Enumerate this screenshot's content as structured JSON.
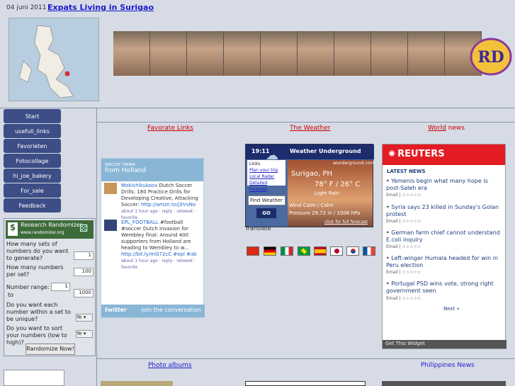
{
  "header": {
    "date": "04 juni 2011",
    "title": "Expats Living in Surigao"
  },
  "nav": [
    "Start",
    "usefull_links",
    "Favorieten",
    "Fotocollage",
    "hi_joe_bakery",
    "For_sale",
    "Feedback"
  ],
  "randomizer": {
    "title": "Research Randomizer",
    "url": "www.randomizer.org",
    "q1": "How many sets of numbers do you want to generate?",
    "v1": "1",
    "q2": "How many numbers per set?",
    "v2": "100",
    "q3": "Number range:",
    "from": "1",
    "to_label": "to",
    "to": "1000",
    "q4": "Do you want each number within a set to be unique?",
    "a4": "Ye",
    "q5": "Do you want to sort your numbers (low to high)?",
    "a5": "Ye",
    "button": "Randomize Now!"
  },
  "sections": {
    "fav": "Favorate Links",
    "weather": "The Weather",
    "world": "World",
    "world_news": " news",
    "photos": "Photo albums",
    "phil": "Philippines News"
  },
  "twitter": {
    "head1": "soccer news",
    "head2": "from Holland",
    "t1_user": "Mokichikukoov",
    "t1_text": " Dutch Soccer Drills: 180 Practice Drills for Developing Creative, Attacking Soccer: ",
    "t1_link": "http://amzn.to/j3VvNo",
    "t1_meta": "about 1 hour ago · reply · retweet · favorite",
    "t2_user": "EPL_FOOTBALL",
    "t2_text": " #football #soccer Dutch invasion for Wembley final: Around 400 supporters from Holland are heading to Wembley to w... ",
    "t2_link": "http://bit.ly/mG72cC #epl #ab",
    "t2_meta": "about 1 hour ago · reply · retweet · favorite",
    "foot": "twitter",
    "join": "join the conversation"
  },
  "weather": {
    "time": "19:11",
    "brand": "Weather Underground",
    "links": [
      "Links",
      "Plan your trip",
      "Local Radar",
      "Detailed Forecast"
    ],
    "city": "Surigao, PH",
    "temp": "78° F / 26° C",
    "cond": "Light Rain",
    "wind": "Wind Calm / Calm",
    "pressure": "Pressure 29.72 in / 1006 hPa",
    "site": "wunderground.com",
    "forecast": "click for full forecast",
    "find_placeholder": "Find Weather",
    "go": "GO"
  },
  "translate": "Translate",
  "reuters": {
    "brand": "REUTERS",
    "latest": "LATEST NEWS",
    "items": [
      "Yemenis begin what many hope is post-Saleh era",
      "Syria says 23 killed in Sunday's Golan protest",
      "German farm chief cannot understand E.coli inquiry",
      "Left-winger Humala headed for win in Peru election",
      "Portugal PSD wins vote, strong right government seen"
    ],
    "email": "Email",
    "next": "Next »",
    "foot": "Get This Widget"
  },
  "colors": {
    "nav_bg": "#3d4d86",
    "reuters_red": "#e31b23",
    "link_red": "#cc0000"
  }
}
